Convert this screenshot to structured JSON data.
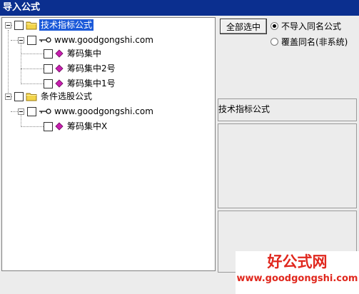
{
  "window": {
    "title": "导入公式"
  },
  "tree": {
    "root1": {
      "label": "技术指标公式",
      "site": {
        "label": "www.goodgongshi.com",
        "items": [
          {
            "label": "筹码集中"
          },
          {
            "label": "筹码集中2号"
          },
          {
            "label": "筹码集中1号"
          }
        ]
      }
    },
    "root2": {
      "label": "条件选股公式",
      "site": {
        "label": "www.goodgongshi.com",
        "items": [
          {
            "label": "筹码集中X"
          }
        ]
      }
    }
  },
  "actions": {
    "select_all": "全部选中",
    "option_skip": "不导入同名公式",
    "option_overwrite": "覆盖同名(非系统)",
    "selected_option": "skip"
  },
  "details": {
    "category": "技术指标公式"
  },
  "watermark": {
    "title": "好公式网",
    "url": "www.goodgongshi.com"
  },
  "colors": {
    "titlebar": "#0b2f8f",
    "selection": "#1c5ad9",
    "watermark": "#e0271d",
    "gem": "#c81fb0",
    "folder": "#f2d44a"
  }
}
